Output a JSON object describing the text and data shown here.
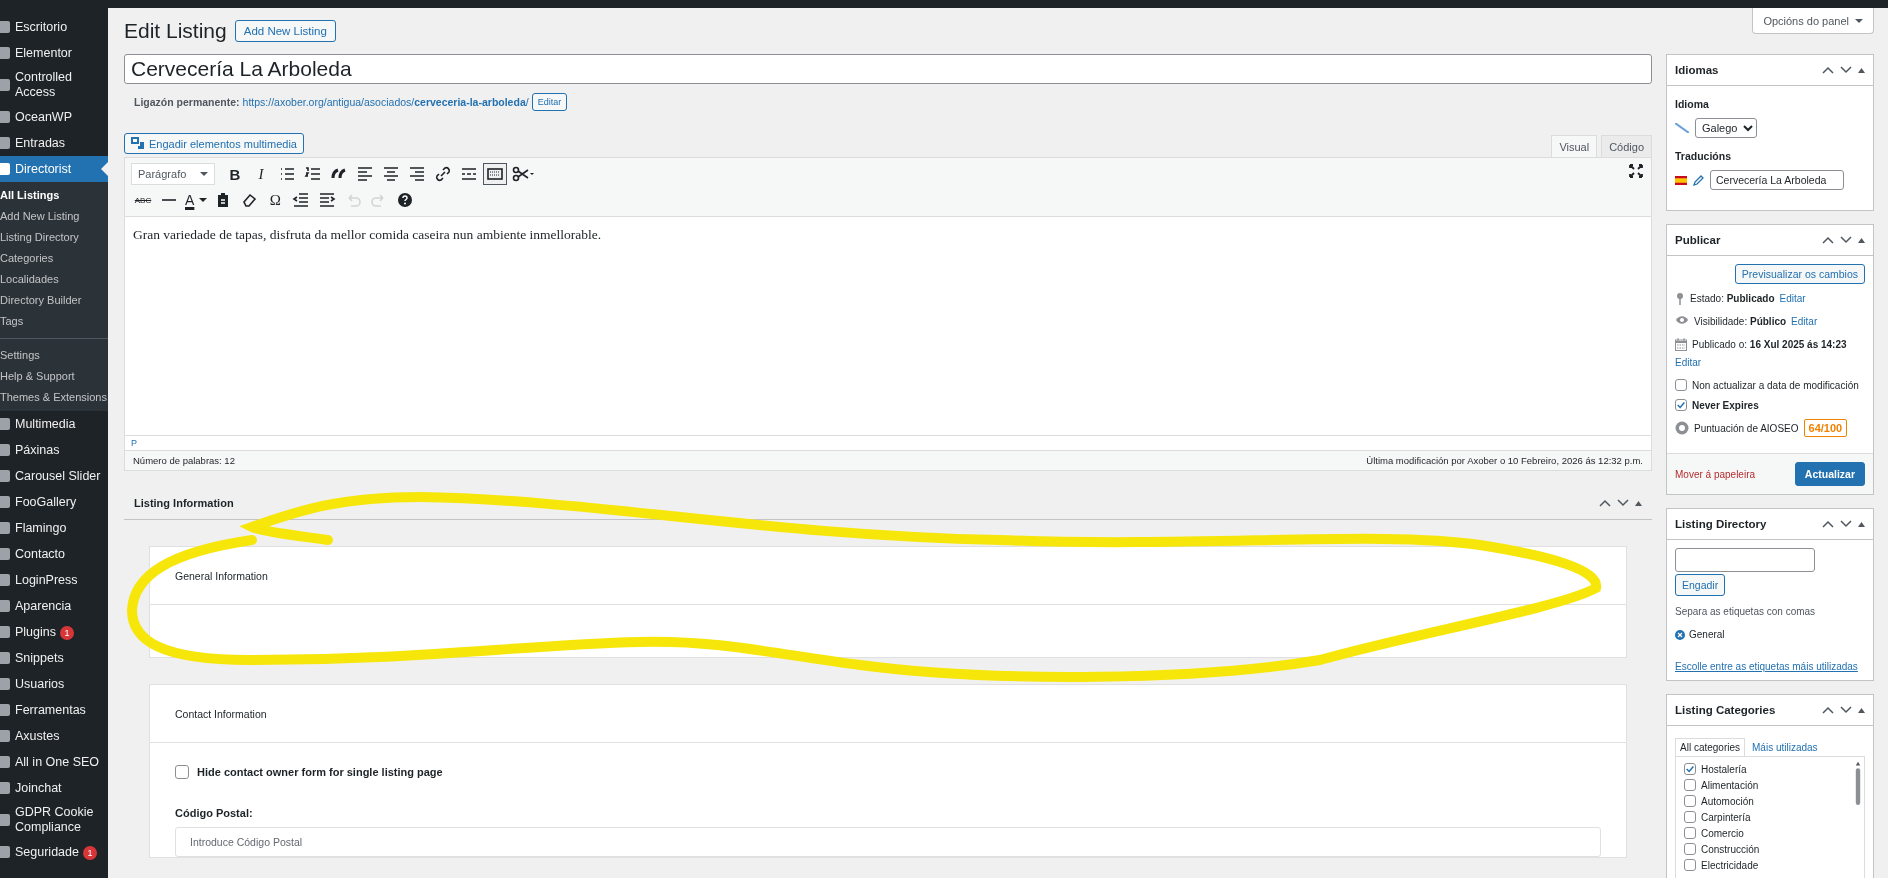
{
  "sidebar": {
    "items": [
      {
        "label": "Escritorio",
        "selected": false
      },
      {
        "label": "Elementor",
        "selected": false
      },
      {
        "label": "Controlled Access",
        "selected": false
      },
      {
        "label": "OceanWP",
        "selected": false
      },
      {
        "label": "Entradas",
        "selected": false
      },
      {
        "label": "Directorist",
        "selected": true,
        "submenu": [
          {
            "items": [
              {
                "label": "All Listings",
                "selected": true
              },
              {
                "label": "Add New Listing",
                "selected": false
              },
              {
                "label": "Listing Directory",
                "selected": false
              },
              {
                "label": "Categories",
                "selected": false
              },
              {
                "label": "Localidades",
                "selected": false
              },
              {
                "label": "Directory Builder",
                "selected": false
              },
              {
                "label": "Tags",
                "selected": false
              }
            ]
          },
          {
            "items": [
              {
                "label": "Settings",
                "selected": false
              },
              {
                "label": "Help & Support",
                "selected": false
              },
              {
                "label": "Themes & Extensions",
                "selected": false
              }
            ]
          }
        ]
      },
      {
        "label": "Multimedia",
        "selected": false
      },
      {
        "label": "Páxinas",
        "selected": false
      },
      {
        "label": "Carousel Slider",
        "selected": false
      },
      {
        "label": "FooGallery",
        "selected": false
      },
      {
        "label": "Flamingo",
        "selected": false
      },
      {
        "label": "Contacto",
        "selected": false
      },
      {
        "label": "LoginPress",
        "selected": false
      },
      {
        "label": "Aparencia",
        "selected": false
      },
      {
        "label": "Plugins",
        "selected": false,
        "badge": "1"
      },
      {
        "label": "Snippets",
        "selected": false
      },
      {
        "label": "Usuarios",
        "selected": false
      },
      {
        "label": "Ferramentas",
        "selected": false
      },
      {
        "label": "Axustes",
        "selected": false
      },
      {
        "label": "All in One SEO",
        "selected": false
      },
      {
        "label": "Joinchat",
        "selected": false
      },
      {
        "label": "GDPR Cookie Compliance",
        "selected": false
      },
      {
        "label": "Seguridade",
        "selected": false,
        "badge": "1"
      }
    ]
  },
  "header": {
    "title": "Edit Listing",
    "add_new_button": "Add New Listing",
    "screen_options": "Opcións do panel"
  },
  "title_field": {
    "value": "Cervecería La Arboleda"
  },
  "permalink": {
    "label": "Ligazón permanente:",
    "url": "https://axober.org/antigua/asociados/**cerveceria-la-arboleda**/",
    "edit_button": "Editar"
  },
  "editor": {
    "media_button": "Engadir elementos multimedia",
    "tabs": [
      {
        "label": "Visual",
        "selected": true
      },
      {
        "label": "Código",
        "selected": false
      }
    ],
    "toolbar_rows": [
      [
        {
          "kind": "format",
          "label": "Parágrafo",
          "pressed": false,
          "disabled": false
        },
        {
          "kind": "bold",
          "glyph": "B",
          "pressed": false,
          "disabled": false
        },
        {
          "kind": "italic",
          "glyph": "I",
          "pressed": false,
          "disabled": false
        },
        {
          "kind": "bullets",
          "pressed": false,
          "disabled": false
        },
        {
          "kind": "numbers",
          "pressed": false,
          "disabled": false
        },
        {
          "kind": "quote",
          "pressed": false,
          "disabled": false
        },
        {
          "kind": "alignleft",
          "pressed": false,
          "disabled": false
        },
        {
          "kind": "aligncenter",
          "pressed": false,
          "disabled": false
        },
        {
          "kind": "alignright",
          "pressed": false,
          "disabled": false
        },
        {
          "kind": "link",
          "pressed": false,
          "disabled": false
        },
        {
          "kind": "more",
          "pressed": false,
          "disabled": false
        },
        {
          "kind": "toggle",
          "pressed": true,
          "disabled": false
        },
        {
          "kind": "scissors",
          "pressed": false,
          "disabled": false
        }
      ],
      [
        {
          "kind": "strike",
          "glyph": "ABC",
          "pressed": false,
          "disabled": false
        },
        {
          "kind": "hr",
          "pressed": false,
          "disabled": false
        },
        {
          "kind": "color",
          "glyph": "A",
          "pressed": false,
          "disabled": false
        },
        {
          "kind": "paste",
          "pressed": false,
          "disabled": false
        },
        {
          "kind": "eraser",
          "pressed": false,
          "disabled": false
        },
        {
          "kind": "char",
          "glyph": "Ω",
          "pressed": false,
          "disabled": false
        },
        {
          "kind": "outdent",
          "pressed": false,
          "disabled": false
        },
        {
          "kind": "indent",
          "pressed": false,
          "disabled": false
        },
        {
          "kind": "undo",
          "pressed": false,
          "disabled": true
        },
        {
          "kind": "redo",
          "pressed": false,
          "disabled": true
        },
        {
          "kind": "help",
          "pressed": false,
          "disabled": false
        }
      ]
    ],
    "content": "Gran variedade de tapas, disfruta da mellor comida caseira nun ambiente inmellorable.",
    "path": "P",
    "word_count": "Número de palabras: 12",
    "last_modified": "Última modificación por Axober o 10 Febreiro, 2026 ás 12:32 p.m."
  },
  "listing_information": {
    "title": "Listing Information",
    "sections": [
      {
        "title": "General Information"
      },
      {
        "title": "Contact Information",
        "checkbox": {
          "label": "Hide contact owner form for single listing page",
          "checked": false
        },
        "fields": [
          {
            "label": "Código Postal:",
            "placeholder": "Introduce Código Postal"
          }
        ]
      }
    ]
  },
  "idiomas": {
    "title": "Idiomas",
    "language_label": "Idioma",
    "language": "Galego",
    "translations_label": "Traducións",
    "translation": "Cervecería La Arboleda"
  },
  "publicar": {
    "title": "Publicar",
    "preview_button": "Previsualizar os cambios",
    "rows": [
      {
        "kind": "status",
        "label": "Estado:",
        "value": "Publicado",
        "link": "Editar"
      },
      {
        "kind": "visibility",
        "label": "Visibilidade:",
        "value": "Público",
        "link": "Editar"
      },
      {
        "kind": "date",
        "label": "Publicado o:",
        "value": "16 Xul 2025 ás 14:23",
        "link": "Editar"
      }
    ],
    "checkboxes": [
      {
        "label": "Non actualizar a data de modificación",
        "checked": false
      },
      {
        "label": "Never Expires",
        "checked": true
      }
    ],
    "aioseo": {
      "label": "Puntuación de AIOSEO",
      "score": "64/100"
    },
    "trash_link": "Mover á papeleira",
    "update_button": "Actualizar"
  },
  "listing_directory": {
    "title": "Listing Directory",
    "add_button": "Engadir",
    "hint": "Separa as etiquetas con comas",
    "tags": [
      {
        "label": "General"
      }
    ],
    "link": "Escolle entre as etiquetas máis utilizadas"
  },
  "listing_categories": {
    "title": "Listing Categories",
    "tabs": [
      {
        "label": "All categories",
        "selected": true
      },
      {
        "label": "Máis utilizadas",
        "selected": false
      }
    ],
    "items": [
      {
        "label": "Hostalería",
        "checked": true
      },
      {
        "label": "Alimentación",
        "checked": false
      },
      {
        "label": "Automoción",
        "checked": false
      },
      {
        "label": "Carpintería",
        "checked": false
      },
      {
        "label": "Comercio",
        "checked": false
      },
      {
        "label": "Construcción",
        "checked": false
      },
      {
        "label": "Electricidade",
        "checked": false
      }
    ]
  }
}
